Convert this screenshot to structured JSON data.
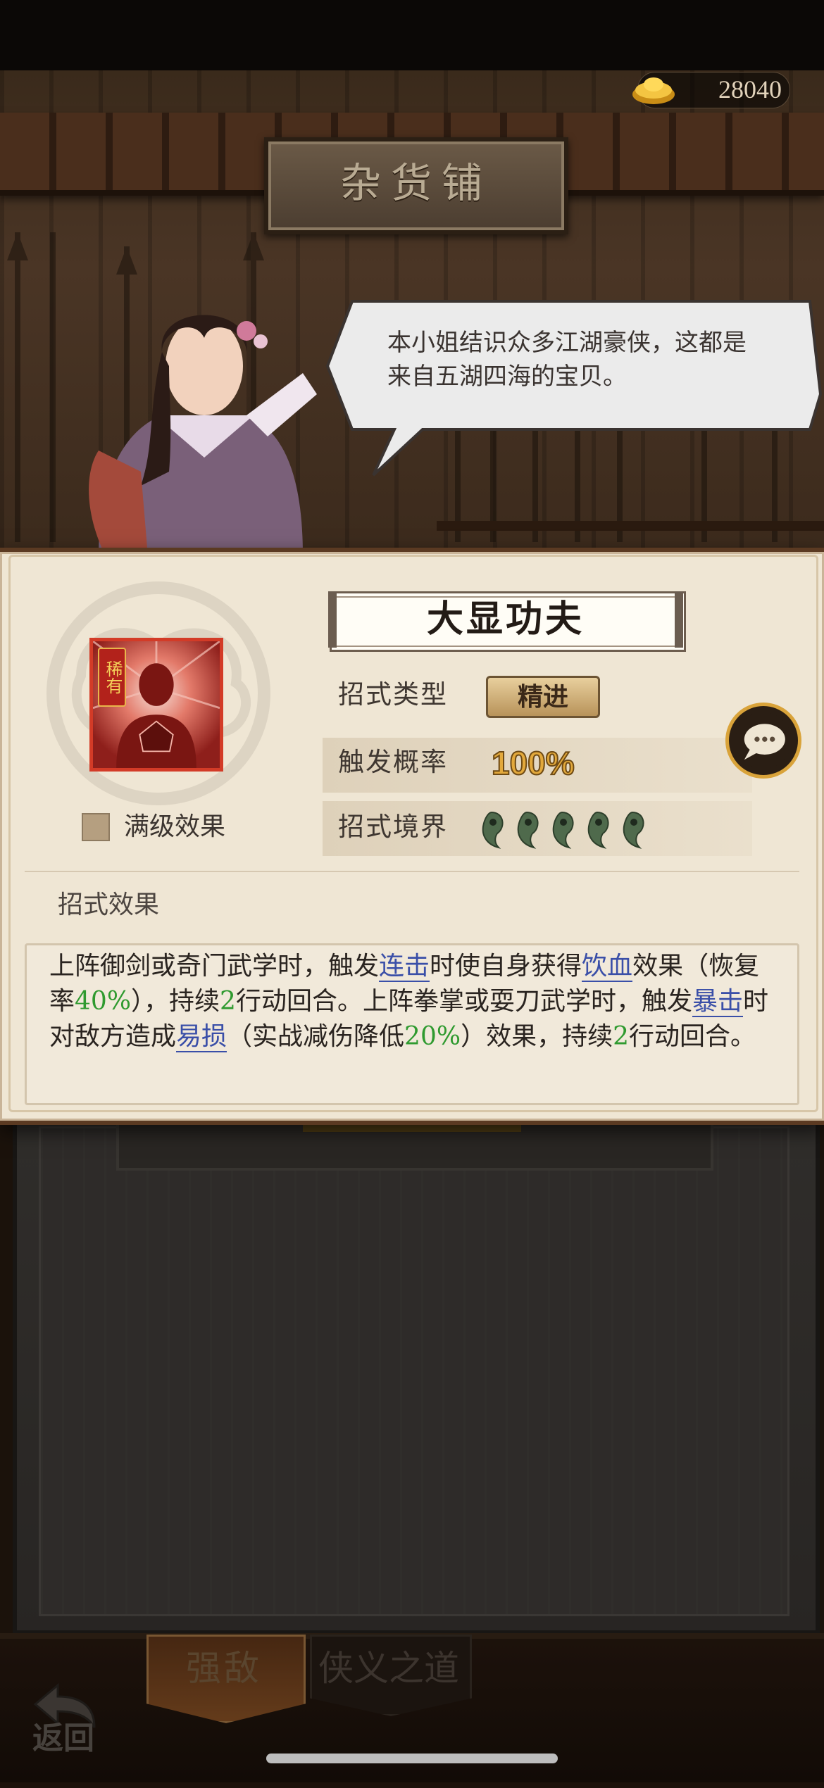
{
  "currency": {
    "icon": "gold-ingot-icon",
    "amount": "28040"
  },
  "shop": {
    "title": "杂货铺"
  },
  "shopkeeper": {
    "speech": "本小姐结识众多江湖豪侠，这都是来自五湖四海的宝贝。"
  },
  "skill": {
    "name": "大显功夫",
    "rarity_badge": "稀有",
    "max_level_label": "满级效果",
    "type_label": "招式类型",
    "type_value": "精进",
    "trigger_label": "触发概率",
    "trigger_value": "100%",
    "realm_label": "招式境界",
    "realm_level": 5,
    "effect_header": "招式效果",
    "effect": {
      "p1": "上阵御剑或奇门武学时，触发",
      "kw1": "连击",
      "p2": "时使自身获得",
      "kw2": "饮血",
      "p3": "效果（恢复率",
      "n1": "40%",
      "p4": "），持续",
      "n2": "2",
      "p5": "行动回合。上阵拳掌或耍刀武学时，触发",
      "kw3": "暴击",
      "p6": "时对敌方造成",
      "kw4": "易损",
      "p7": "（实战减伤降低",
      "n3": "20%",
      "p8": "）效果，持续",
      "n4": "2",
      "p9": "行动回合。"
    }
  },
  "nav": {
    "tab1": "强敌",
    "tab2": "侠义之道",
    "back": "返回"
  },
  "colors": {
    "accent_gold": "#d9a33a",
    "keyword_blue": "#3a4fa8",
    "number_green": "#2f9a2f",
    "rarity_red": "#d33b27"
  }
}
